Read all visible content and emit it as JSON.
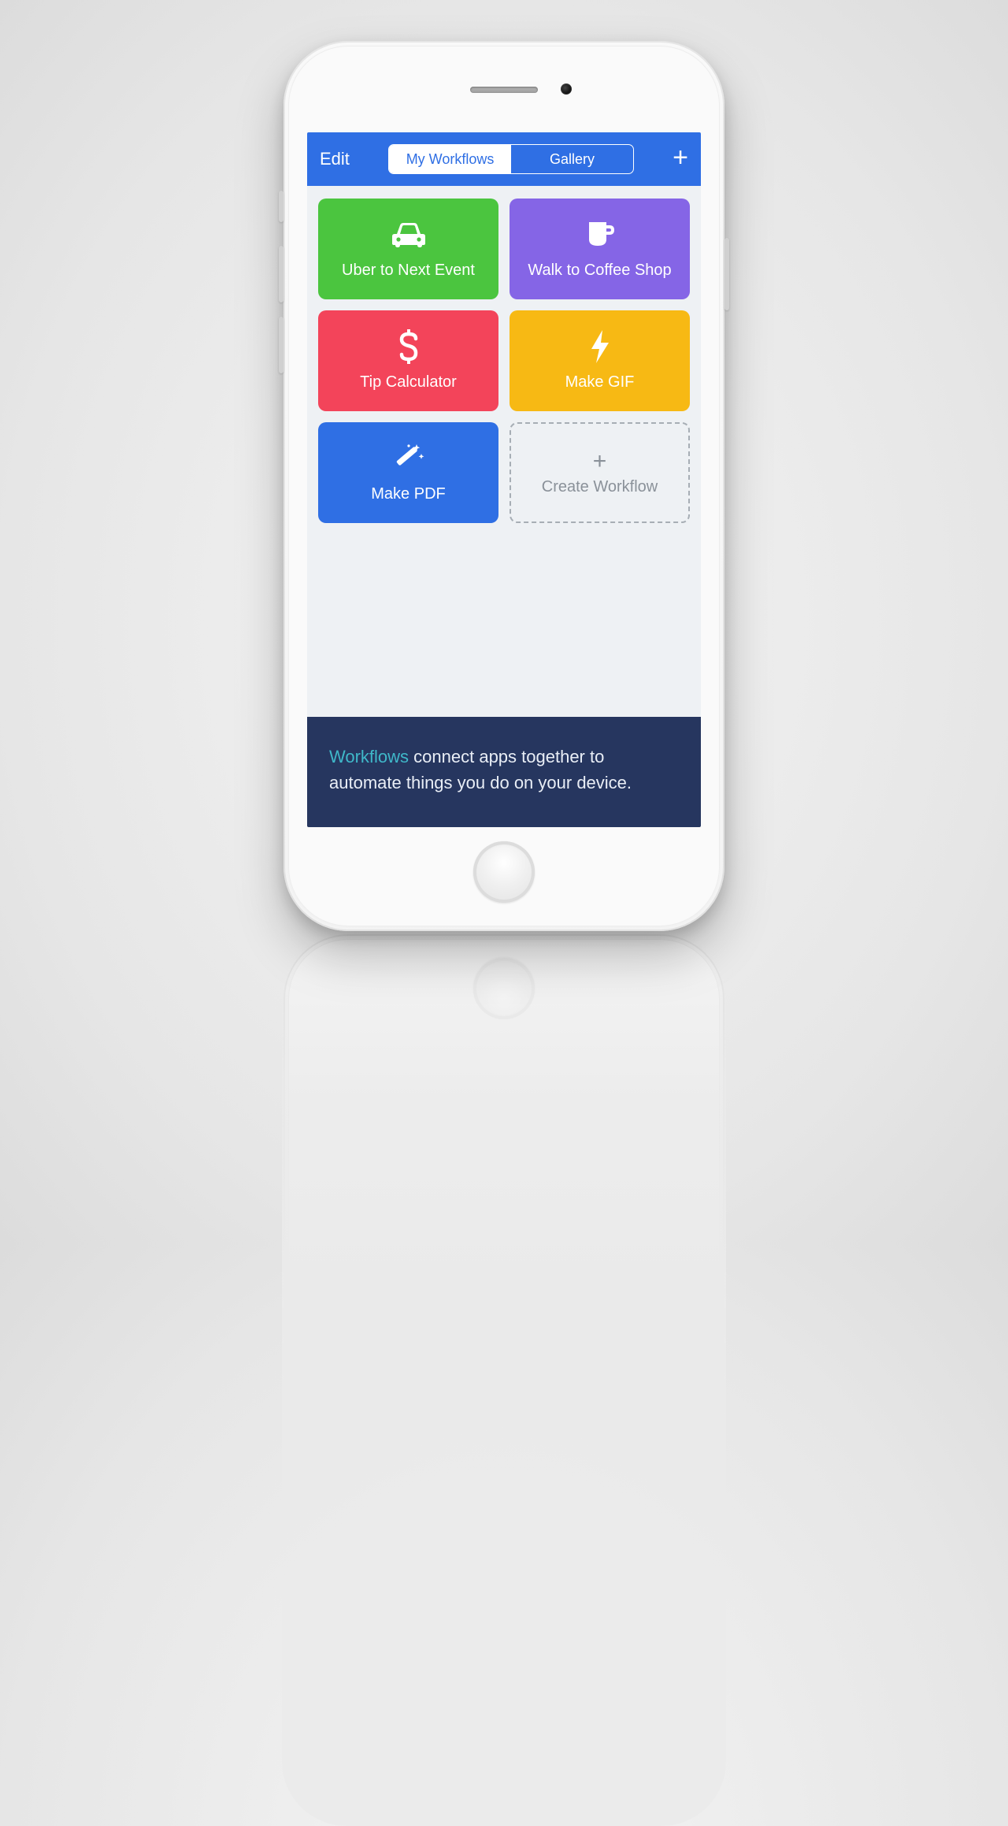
{
  "navbar": {
    "edit_label": "Edit",
    "tabs": {
      "my": "My Workflows",
      "gallery": "Gallery"
    },
    "active_tab": "my"
  },
  "tiles": [
    {
      "id": 0,
      "label": "Uber to Next Event",
      "color": "t-green",
      "icon": "car-icon"
    },
    {
      "id": 1,
      "label": "Walk to Coffee Shop",
      "color": "t-purple",
      "icon": "mug-icon"
    },
    {
      "id": 2,
      "label": "Tip Calculator",
      "color": "t-red",
      "icon": "dollar-icon"
    },
    {
      "id": 3,
      "label": "Make GIF",
      "color": "t-yellow",
      "icon": "bolt-icon"
    },
    {
      "id": 4,
      "label": "Make PDF",
      "color": "t-blue",
      "icon": "wand-icon"
    }
  ],
  "create_tile": {
    "label": "Create Workflow"
  },
  "banner": {
    "highlight": "Workflows",
    "rest": " connect apps together to automate things you do on your device."
  }
}
